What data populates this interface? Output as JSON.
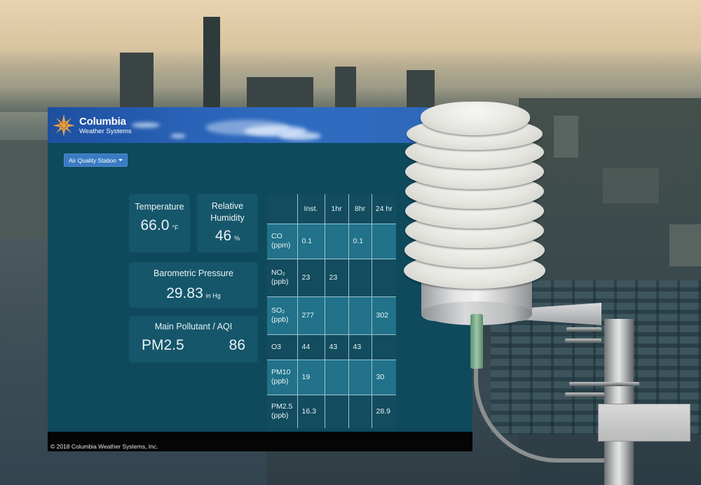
{
  "app": {
    "brand": {
      "title": "Columbia",
      "subtitle": "Weather Systems"
    },
    "station_menu": {
      "label": "Air Quality Station",
      "icon": "caret-down-icon"
    },
    "cards": {
      "temperature": {
        "label": "Temperature",
        "value": "66.0",
        "unit": "°F"
      },
      "humidity": {
        "label_line1": "Relative",
        "label_line2": "Humidity",
        "value": "46",
        "unit": "%"
      },
      "pressure": {
        "label": "Barometric Pressure",
        "value": "29.83",
        "unit": "in Hg"
      },
      "pollutant": {
        "label": "Main Pollutant / AQI",
        "pollutant": "PM2.5",
        "aqi": "86"
      }
    },
    "table": {
      "headers": [
        "",
        "Inst.",
        "1hr",
        "8hr",
        "24 hr"
      ],
      "rows": [
        {
          "name": "CO",
          "unit": "(ppm)",
          "inst": "0.1",
          "h1": "",
          "h8": "0.1",
          "h24": ""
        },
        {
          "name": "NO₂",
          "unit": "(ppb)",
          "inst": "23",
          "h1": "23",
          "h8": "",
          "h24": ""
        },
        {
          "name": "SO₂",
          "unit": "(ppb)",
          "inst": "277",
          "h1": "",
          "h8": "",
          "h24": "302"
        },
        {
          "name": "O3",
          "unit": "",
          "inst": "44",
          "h1": "43",
          "h8": "43",
          "h24": ""
        },
        {
          "name": "PM10",
          "unit": "(ppb)",
          "inst": "19",
          "h1": "",
          "h8": "",
          "h24": "30"
        },
        {
          "name": "PM2.5",
          "unit": "(ppb)",
          "inst": "16.3",
          "h1": "",
          "h8": "",
          "h24": "28.9"
        }
      ]
    },
    "footer": {
      "copyright": "© 2018 Columbia Weather Systems, Inc."
    }
  },
  "colors": {
    "header_blue": "#2a63b8",
    "panel_teal": "#0e4a5c",
    "card_teal": "#16566a",
    "button_blue": "#3a7bc4",
    "footer_black": "#050505",
    "logo_sun": "#e3a24a"
  }
}
